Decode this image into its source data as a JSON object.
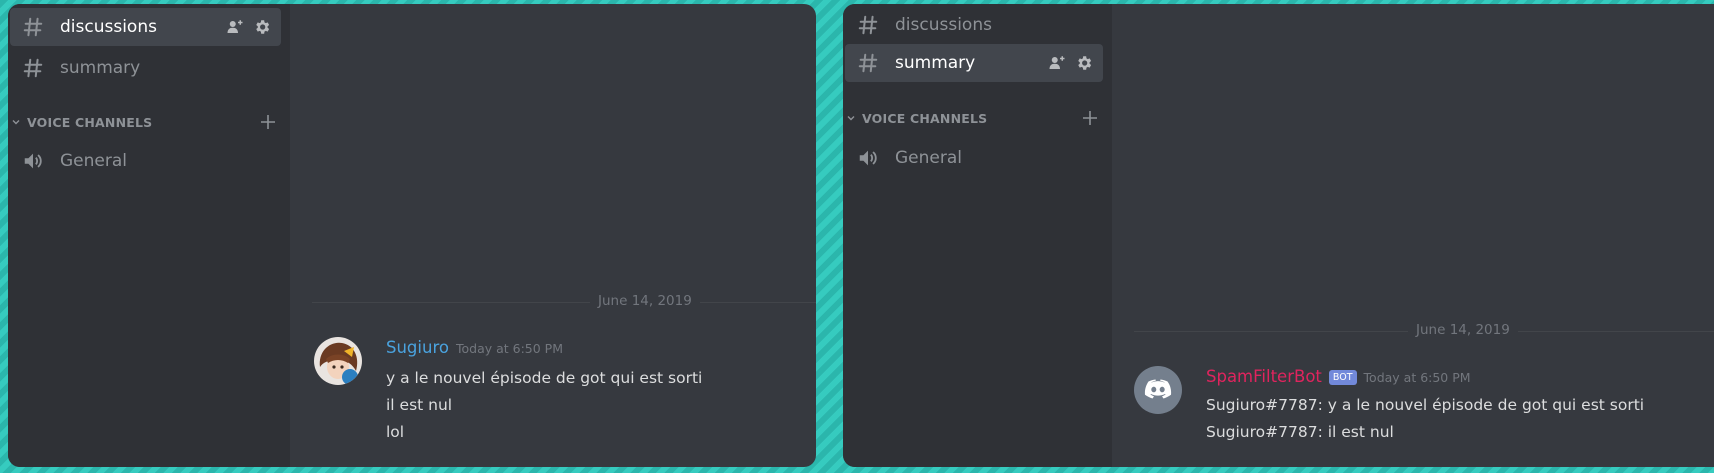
{
  "left": {
    "channels": [
      {
        "label": "discussions",
        "selected": true
      },
      {
        "label": "summary",
        "selected": false
      }
    ],
    "category": "VOICE CHANNELS",
    "voice_channels": [
      {
        "label": "General"
      }
    ],
    "date_divider": "June 14, 2019",
    "message": {
      "author": "Sugiuro",
      "timestamp": "Today at 6:50 PM",
      "lines": [
        "y a le nouvel épisode de got qui est sorti",
        "il est nul",
        "lol"
      ]
    }
  },
  "right": {
    "channels": [
      {
        "label": "discussions",
        "selected": false
      },
      {
        "label": "summary",
        "selected": true
      }
    ],
    "category": "VOICE CHANNELS",
    "voice_channels": [
      {
        "label": "General"
      }
    ],
    "date_divider": "June 14, 2019",
    "message": {
      "author": "SpamFilterBot",
      "bot_tag": "BOT",
      "timestamp": "Today at 6:50 PM",
      "lines": [
        "Sugiuro#7787: y a le nouvel épisode de got qui est sorti",
        "Sugiuro#7787: il est nul"
      ]
    }
  },
  "colors": {
    "background_teal": "#36cbbf",
    "sidebar": "#2f3136",
    "chat": "#36393f",
    "user_author": "#4aa3df",
    "bot_author": "#e0245e",
    "bot_tag": "#7289da",
    "discord_blurple": "#747f8d"
  },
  "icons": {
    "channel": "hash-icon",
    "invite": "add-member-icon",
    "settings": "gear-icon",
    "category_collapse": "chevron-down-icon",
    "category_add": "plus-icon",
    "voice": "speaker-icon",
    "bot_avatar": "discord-logo-icon"
  }
}
